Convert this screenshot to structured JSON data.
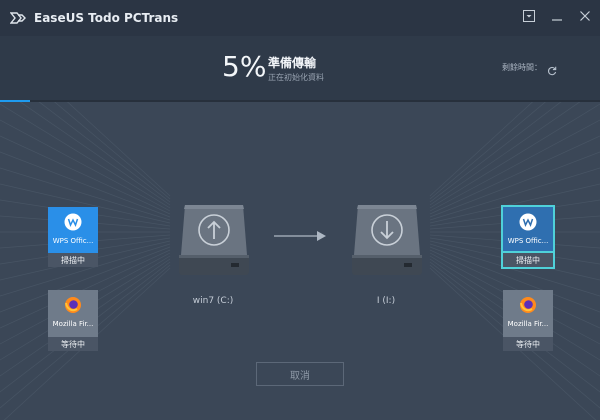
{
  "window": {
    "title": "EaseUS Todo PCTrans",
    "controls": [
      "dropdown-icon",
      "minimize-icon",
      "close-icon"
    ]
  },
  "progress": {
    "percent_text": "5%",
    "percent_value": 5,
    "title": "準備傳輸",
    "subtitle": "正在初始化資料",
    "remaining_label": "剩餘時間：",
    "accent": "#1e9bf0"
  },
  "source": {
    "drive_label": "win7 (C:)",
    "apps": [
      {
        "name": "WPS Offic...",
        "status": "掃描中",
        "icon": "wps-icon",
        "color": "#2a8fe8"
      },
      {
        "name": "Mozilla Fir...",
        "status": "等待中",
        "icon": "firefox-icon",
        "color": "#6f7b8a"
      }
    ]
  },
  "target": {
    "drive_label": "I (I:)",
    "apps": [
      {
        "name": "WPS Offic...",
        "status": "掃描中",
        "icon": "wps-icon",
        "color": "#2f6fb0"
      },
      {
        "name": "Mozilla Fir...",
        "status": "等待中",
        "icon": "firefox-icon",
        "color": "#6f7b8a"
      }
    ]
  },
  "actions": {
    "cancel_label": "取消"
  }
}
